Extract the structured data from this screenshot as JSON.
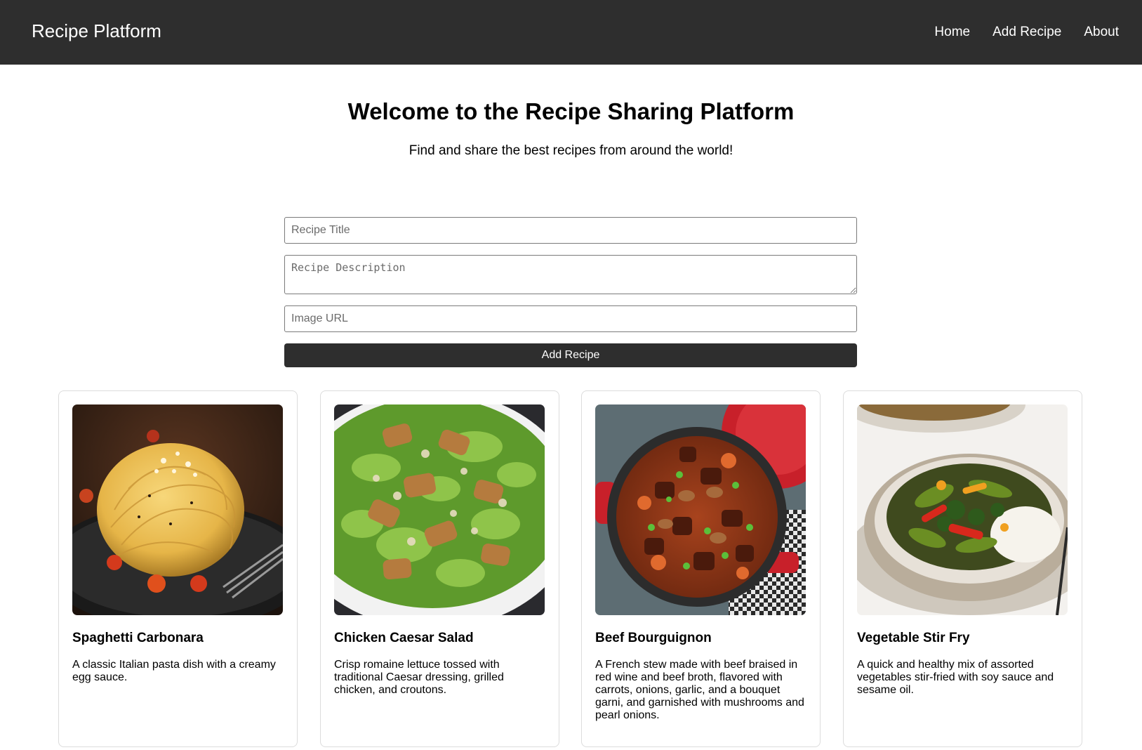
{
  "navbar": {
    "brand": "Recipe Platform",
    "links": [
      "Home",
      "Add Recipe",
      "About"
    ]
  },
  "hero": {
    "title": "Welcome to the Recipe Sharing Platform",
    "subtitle": "Find and share the best recipes from around the world!"
  },
  "form": {
    "title_placeholder": "Recipe Title",
    "title_value": "",
    "description_placeholder": "Recipe Description",
    "description_value": "",
    "image_url_placeholder": "Image URL",
    "image_url_value": "",
    "submit_label": "Add Recipe"
  },
  "recipes": [
    {
      "title": "Spaghetti Carbonara",
      "description": "A classic Italian pasta dish with a creamy egg sauce.",
      "image": "spaghetti-photo"
    },
    {
      "title": "Chicken Caesar Salad",
      "description": "Crisp romaine lettuce tossed with traditional Caesar dressing, grilled chicken, and croutons.",
      "image": "salad-photo"
    },
    {
      "title": "Beef Bourguignon",
      "description": "A French stew made with beef braised in red wine and beef broth, flavored with carrots, onions, garlic, and a bouquet garni, and garnished with mushrooms and pearl onions.",
      "image": "stew-photo"
    },
    {
      "title": "Vegetable Stir Fry",
      "description": "A quick and healthy mix of assorted vegetables stir-fried with soy sauce and sesame oil.",
      "image": "stir-fry-photo"
    }
  ],
  "colors": {
    "navbar_bg": "#2e2e2e",
    "button_bg": "#2e2e2e",
    "card_border": "#dcdcdc"
  }
}
